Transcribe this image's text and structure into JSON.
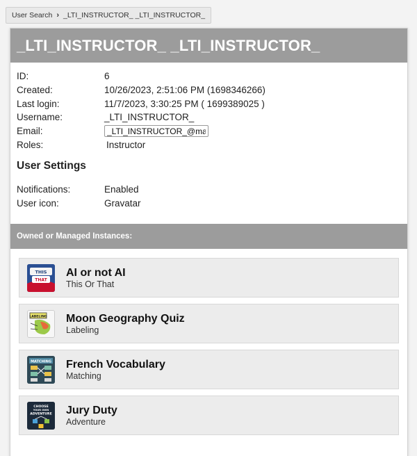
{
  "breadcrumb": {
    "root": "User Search",
    "current": "_LTI_INSTRUCTOR_ _LTI_INSTRUCTOR_"
  },
  "user": {
    "full_name": "_LTI_INSTRUCTOR_ _LTI_INSTRUCTOR_",
    "fields": {
      "id_label": "ID:",
      "id_value": "6",
      "created_label": "Created:",
      "created_value": "10/26/2023, 2:51:06 PM (1698346266)",
      "last_login_label": "Last login:",
      "last_login_value": "11/7/2023, 3:30:25 PM ( 1699389025 )",
      "username_label": "Username:",
      "username_value": "_LTI_INSTRUCTOR_",
      "email_label": "Email:",
      "email_value": "_LTI_INSTRUCTOR_@materia",
      "roles_label": "Roles:",
      "roles_value": "Instructor"
    }
  },
  "settings": {
    "title": "User Settings",
    "notifications_label": "Notifications:",
    "notifications_value": "Enabled",
    "user_icon_label": "User icon:",
    "user_icon_value": "Gravatar"
  },
  "instances": {
    "title": "Owned or Managed Instances:",
    "items": [
      {
        "name": "AI or not AI",
        "type": "This Or That",
        "icon": "this-or-that-icon",
        "icon_text": "THIS OR THAT"
      },
      {
        "name": "Moon Geography Quiz",
        "type": "Labeling",
        "icon": "labeling-icon",
        "icon_text": "LABELING"
      },
      {
        "name": "French Vocabulary",
        "type": "Matching",
        "icon": "matching-icon",
        "icon_text": "MATCHING"
      },
      {
        "name": "Jury Duty",
        "type": "Adventure",
        "icon": "adventure-icon",
        "icon_text": "CHOOSE YOUR OWN ADVENTURE"
      }
    ]
  }
}
